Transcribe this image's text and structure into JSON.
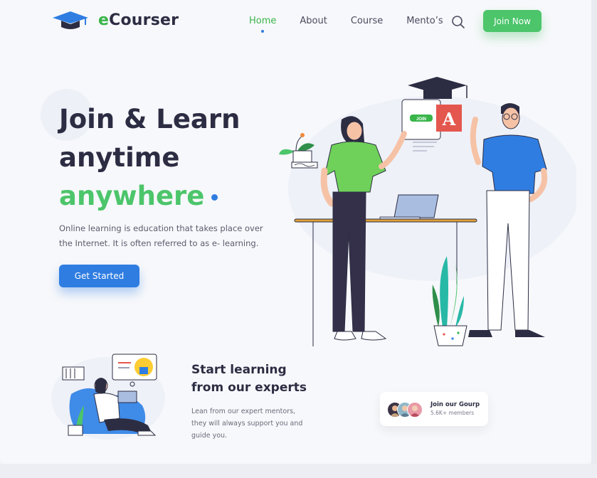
{
  "brand": {
    "name_prefix": "e",
    "name_rest": "Courser"
  },
  "nav": {
    "items": [
      {
        "label": "Home",
        "active": true
      },
      {
        "label": "About",
        "active": false
      },
      {
        "label": "Course",
        "active": false
      },
      {
        "label": "Mento’s",
        "active": false
      }
    ],
    "search_icon": "search-icon",
    "cta_label": "Join Now"
  },
  "hero": {
    "title_line1": "Join & Learn",
    "title_line2": "anytime",
    "title_line3": "anywhere",
    "description": "Online learning is education that takes place over the Internet. It is often referred to as e- learning.",
    "cta_label": "Get Started",
    "illustration": {
      "sign_label": "JOIN",
      "letter": "A"
    }
  },
  "experts": {
    "title_line1": "Start learning",
    "title_line2": "from our experts",
    "description": "Lean from our expert mentors, they will always support you and guide you."
  },
  "group": {
    "title": "Join our Gourp",
    "members": "5.6K+ members"
  },
  "colors": {
    "accent_green": "#4cc56b",
    "accent_blue": "#2f7de1",
    "heading": "#2c2d43"
  }
}
